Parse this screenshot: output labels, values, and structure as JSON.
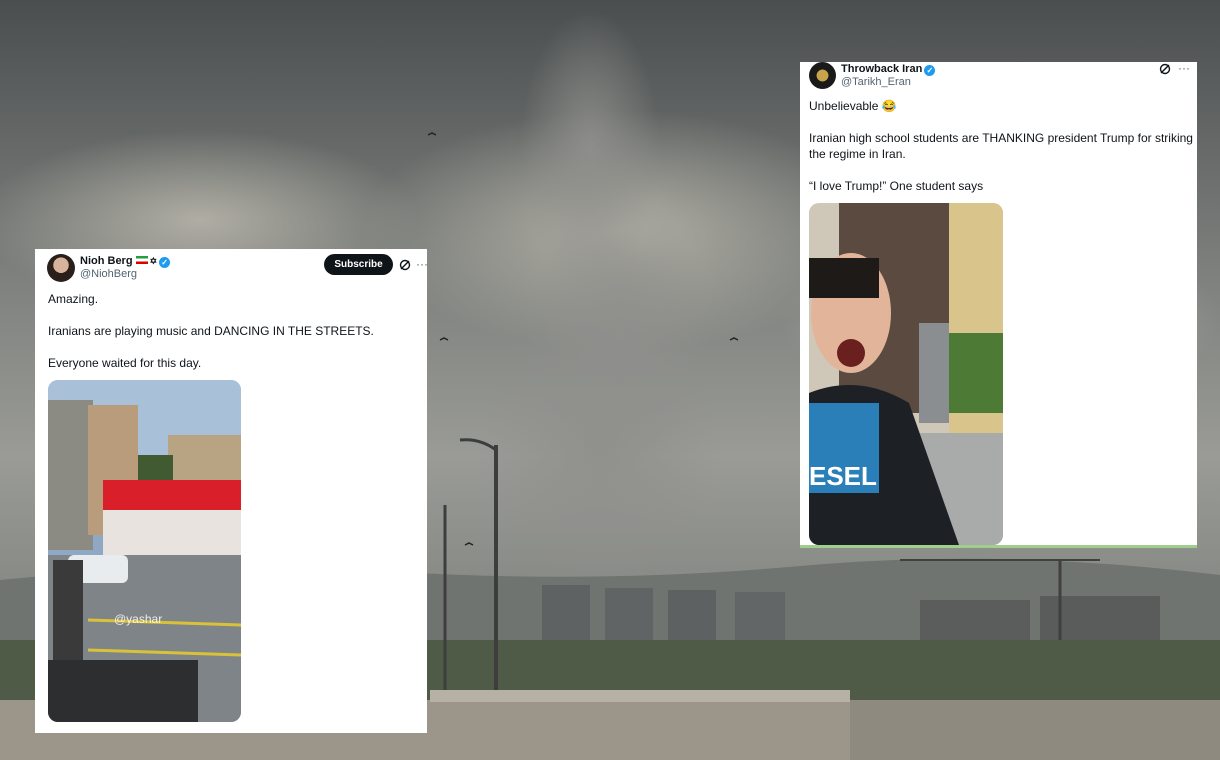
{
  "tweet_left": {
    "author": {
      "name": "Nioh Berg",
      "handle": "@NiohBerg",
      "flag_icon": "iran-flag-icon",
      "symbol": "✡",
      "verified": true
    },
    "subscribe_label": "Subscribe",
    "more_label": "···",
    "lines": [
      "Amazing.",
      "Iranians are playing music and DANCING IN THE STREETS.",
      "Everyone waited for this day."
    ],
    "media_watermark": "@yashar"
  },
  "tweet_right": {
    "author": {
      "name": "Throwback Iran",
      "handle": "@Tarikh_Eran",
      "verified": true
    },
    "more_label": "···",
    "lines": [
      "Unbelievable 😂",
      "Iranian high school students are THANKING president Trump for striking",
      "the regime in Iran.",
      "“I love Trump!” One student says"
    ],
    "media_shirt_text": "ESEL"
  },
  "colors": {
    "verified": "#1d9bf0",
    "primary_text": "#0f1419",
    "secondary_text": "#536471",
    "subscribe_bg": "#0f1419"
  }
}
